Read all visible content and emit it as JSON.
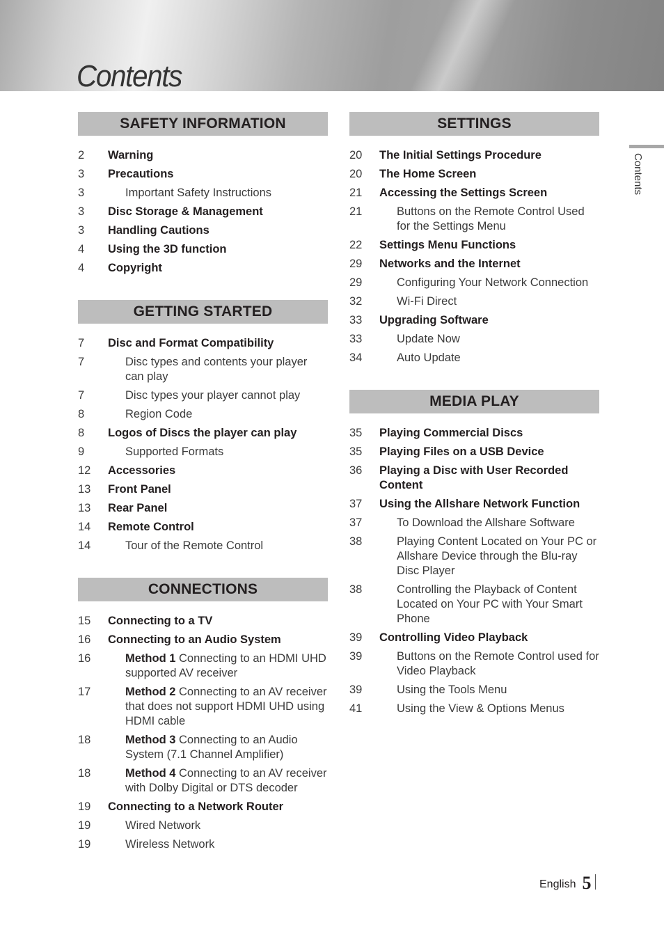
{
  "header": {
    "title": "Contents"
  },
  "side_tab": {
    "label": "Contents"
  },
  "footer": {
    "language": "English",
    "page_number": "5"
  },
  "sections": {
    "safety": {
      "title": "SAFETY INFORMATION",
      "entries": [
        {
          "page": "2",
          "text": "Warning",
          "level": "main"
        },
        {
          "page": "3",
          "text": "Precautions",
          "level": "main"
        },
        {
          "page": "3",
          "text": "Important Safety Instructions",
          "level": "sub"
        },
        {
          "page": "3",
          "text": "Disc Storage & Management",
          "level": "main"
        },
        {
          "page": "3",
          "text": "Handling Cautions",
          "level": "main"
        },
        {
          "page": "4",
          "text": "Using the 3D function",
          "level": "main"
        },
        {
          "page": "4",
          "text": "Copyright",
          "level": "main"
        }
      ]
    },
    "getting_started": {
      "title": "GETTING STARTED",
      "entries": [
        {
          "page": "7",
          "text": "Disc and Format Compatibility",
          "level": "main"
        },
        {
          "page": "7",
          "text": "Disc types and contents your player can play",
          "level": "sub"
        },
        {
          "page": "7",
          "text": "Disc types your player cannot play",
          "level": "sub"
        },
        {
          "page": "8",
          "text": "Region Code",
          "level": "sub"
        },
        {
          "page": "8",
          "text": "Logos of Discs the player can play",
          "level": "main"
        },
        {
          "page": "9",
          "text": "Supported Formats",
          "level": "sub"
        },
        {
          "page": "12",
          "text": "Accessories",
          "level": "main"
        },
        {
          "page": "13",
          "text": "Front Panel",
          "level": "main"
        },
        {
          "page": "13",
          "text": "Rear Panel",
          "level": "main"
        },
        {
          "page": "14",
          "text": "Remote Control",
          "level": "main"
        },
        {
          "page": "14",
          "text": "Tour of the Remote Control",
          "level": "sub"
        }
      ]
    },
    "connections": {
      "title": "CONNECTIONS",
      "entries": [
        {
          "page": "15",
          "text": "Connecting to a TV",
          "level": "main"
        },
        {
          "page": "16",
          "text": "Connecting to an Audio System",
          "level": "main"
        },
        {
          "page": "16",
          "prefix": "Method 1",
          "text": " Connecting to an HDMI UHD supported AV receiver",
          "level": "sub"
        },
        {
          "page": "17",
          "prefix": "Method 2",
          "text": " Connecting to an AV receiver that does not support HDMI UHD using HDMI cable",
          "level": "sub"
        },
        {
          "page": "18",
          "prefix": "Method 3",
          "text": " Connecting to an Audio System (7.1 Channel Amplifier)",
          "level": "sub"
        },
        {
          "page": "18",
          "prefix": "Method 4",
          "text": " Connecting to an AV receiver with Dolby Digital or DTS decoder",
          "level": "sub"
        },
        {
          "page": "19",
          "text": "Connecting to a Network Router",
          "level": "main"
        },
        {
          "page": "19",
          "text": "Wired Network",
          "level": "sub"
        },
        {
          "page": "19",
          "text": "Wireless Network",
          "level": "sub"
        }
      ]
    },
    "settings": {
      "title": "SETTINGS",
      "entries": [
        {
          "page": "20",
          "text": "The Initial Settings Procedure",
          "level": "main"
        },
        {
          "page": "20",
          "text": "The Home Screen",
          "level": "main"
        },
        {
          "page": "21",
          "text": "Accessing the Settings Screen",
          "level": "main"
        },
        {
          "page": "21",
          "text": "Buttons on the Remote Control Used for the Settings Menu",
          "level": "sub"
        },
        {
          "page": "22",
          "text": "Settings Menu Functions",
          "level": "main"
        },
        {
          "page": "29",
          "text": "Networks and the Internet",
          "level": "main"
        },
        {
          "page": "29",
          "text": "Configuring Your Network Connection",
          "level": "sub"
        },
        {
          "page": "32",
          "text": "Wi-Fi Direct",
          "level": "sub"
        },
        {
          "page": "33",
          "text": "Upgrading Software",
          "level": "main"
        },
        {
          "page": "33",
          "text": "Update Now",
          "level": "sub"
        },
        {
          "page": "34",
          "text": "Auto Update",
          "level": "sub"
        }
      ]
    },
    "media_play": {
      "title": "MEDIA PLAY",
      "entries": [
        {
          "page": "35",
          "text": "Playing Commercial Discs",
          "level": "main"
        },
        {
          "page": "35",
          "text": "Playing Files on a USB Device",
          "level": "main"
        },
        {
          "page": "36",
          "text": "Playing a Disc with User Recorded Content",
          "level": "main"
        },
        {
          "page": "37",
          "text": "Using the Allshare Network Function",
          "level": "main"
        },
        {
          "page": "37",
          "text": "To Download the Allshare Software",
          "level": "sub"
        },
        {
          "page": "38",
          "text": "Playing Content Located on Your PC or Allshare Device through the Blu-ray Disc Player",
          "level": "sub"
        },
        {
          "page": "38",
          "text": "Controlling the Playback of Content Located on Your PC with Your Smart Phone",
          "level": "sub"
        },
        {
          "page": "39",
          "text": "Controlling Video Playback",
          "level": "main"
        },
        {
          "page": "39",
          "text": "Buttons on the Remote Control used for Video Playback",
          "level": "sub"
        },
        {
          "page": "39",
          "text": "Using the Tools Menu",
          "level": "sub"
        },
        {
          "page": "41",
          "text": "Using the View & Options Menus",
          "level": "sub"
        }
      ]
    }
  }
}
